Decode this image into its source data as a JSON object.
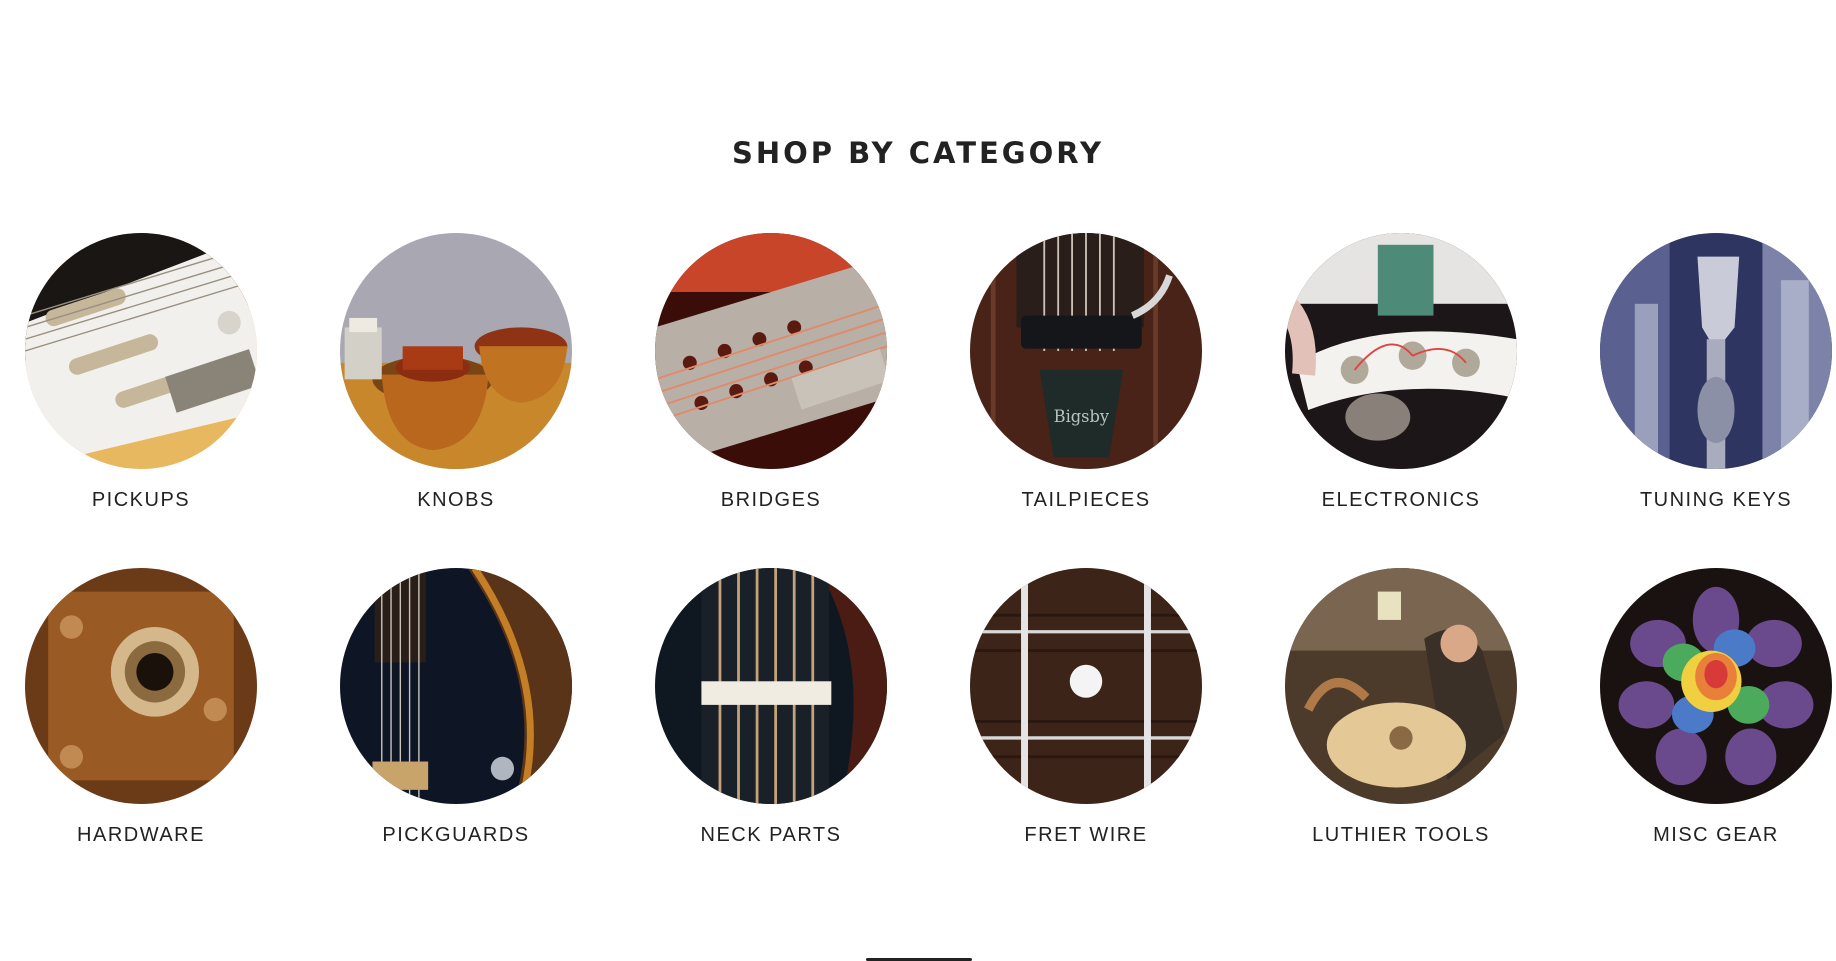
{
  "section": {
    "title": "SHOP BY CATEGORY"
  },
  "categories": [
    {
      "label": "PICKUPS",
      "icon": "pickups-photo"
    },
    {
      "label": "KNOBS",
      "icon": "knobs-photo"
    },
    {
      "label": "BRIDGES",
      "icon": "bridges-photo"
    },
    {
      "label": "TAILPIECES",
      "icon": "tailpieces-photo"
    },
    {
      "label": "ELECTRONICS",
      "icon": "electronics-photo"
    },
    {
      "label": "TUNING KEYS",
      "icon": "tuning-keys-photo"
    },
    {
      "label": "HARDWARE",
      "icon": "hardware-photo"
    },
    {
      "label": "PICKGUARDS",
      "icon": "pickguards-photo"
    },
    {
      "label": "NECK PARTS",
      "icon": "neck-parts-photo"
    },
    {
      "label": "FRET WIRE",
      "icon": "fret-wire-photo"
    },
    {
      "label": "LUTHIER TOOLS",
      "icon": "luthier-tools-photo"
    },
    {
      "label": "MISC GEAR",
      "icon": "misc-gear-photo"
    }
  ],
  "colors": {
    "text": "#222222",
    "background": "#ffffff"
  }
}
